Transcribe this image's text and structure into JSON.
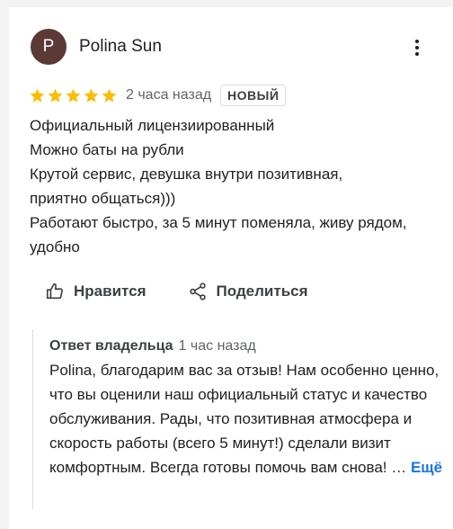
{
  "review": {
    "author_name": "Polina Sun",
    "avatar_letter": "P",
    "rating": 5,
    "max_rating": 5,
    "time_ago": "2 часа назад",
    "badge": "НОВЫЙ",
    "text_lines": [
      "Официальный лицензиированный",
      "Можно баты на рубли",
      "Крутой сервис, девушка внутри позитивная,",
      "приятно общаться)))",
      "Работают быстро, за 5 минут поменяла, живу рядом,",
      "удобно"
    ]
  },
  "actions": {
    "like_label": "Нравится",
    "share_label": "Поделиться"
  },
  "owner_reply": {
    "label": "Ответ владельца",
    "time_ago": "1 час назад",
    "text": "Polina, благодарим вас за отзыв! Нам особенно ценно, что вы оценили наш официальный статус и качество обслуживания. Рады, что позитивная атмосфера и скорость работы (всего 5 минут!) сделали визит комфортным. Всегда готовы помочь вам снова! …",
    "more_label": "Ещё"
  },
  "colors": {
    "star": "#fbbc04",
    "avatar_bg": "#5b3a35",
    "link": "#1a73e8"
  }
}
